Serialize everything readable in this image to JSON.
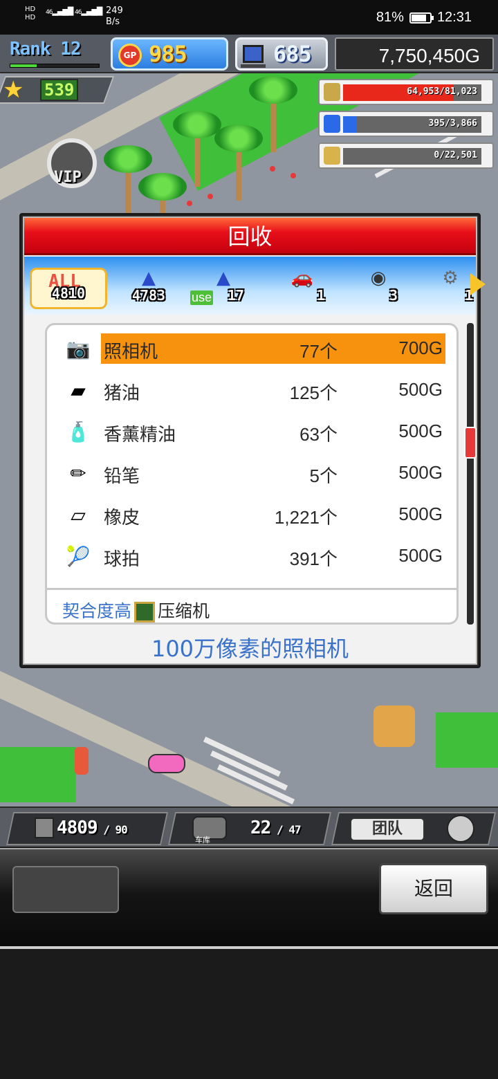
{
  "status_bar": {
    "sim_labels": [
      "HD",
      "HD"
    ],
    "sim1": "46",
    "sim2": "46",
    "net_speed": "249",
    "net_unit": "B/s",
    "battery": "81%",
    "battery_level": 0.81,
    "time": "12:31"
  },
  "hud": {
    "rank_label": "Rank",
    "rank_value": "12",
    "rank_progress": 0.3,
    "gp_icon_text": "GP",
    "gp_value": "985",
    "pc_value": "685",
    "money": "7,750,450G",
    "star_value": "539",
    "resources": [
      {
        "text": "64,953/81,023",
        "fraction": 0.8,
        "color": "#e8281a",
        "icon": "coin-stack-icon"
      },
      {
        "text": "395/3,866",
        "fraction": 0.1,
        "color": "#2a6ae8",
        "icon": "fuel-can-icon"
      },
      {
        "text": "0/22,501",
        "fraction": 0.0,
        "color": "#888888",
        "icon": "wheat-icon"
      }
    ],
    "vip_label": "VIP"
  },
  "dialog": {
    "title": "回收",
    "tabs": [
      {
        "label": "ALL",
        "count": "4810",
        "icon": "all-icon"
      },
      {
        "count": "4783",
        "icon": "item-dome-icon"
      },
      {
        "use_label": "use",
        "count": "17",
        "icon": "item-dome-use-icon"
      },
      {
        "count": "1",
        "icon": "car-icon"
      },
      {
        "count": "3",
        "icon": "tire-icon"
      },
      {
        "count": "1",
        "icon": "engine-icon"
      }
    ],
    "items": [
      {
        "name": "照相机",
        "qty": "77个",
        "price": "700G",
        "icon": "camera-icon",
        "selected": true
      },
      {
        "name": "猪油",
        "qty": "125个",
        "price": "500G",
        "icon": "lard-icon",
        "selected": false
      },
      {
        "name": "香薰精油",
        "qty": "63个",
        "price": "500G",
        "icon": "perfume-bottle-icon",
        "selected": false
      },
      {
        "name": "铅笔",
        "qty": "5个",
        "price": "500G",
        "icon": "pencil-icon",
        "selected": false
      },
      {
        "name": "橡皮",
        "qty": "1,221个",
        "price": "500G",
        "icon": "eraser-icon",
        "selected": false
      },
      {
        "name": "球拍",
        "qty": "391个",
        "price": "500G",
        "icon": "racket-icon",
        "selected": false
      }
    ],
    "affinity_label": "契合度高",
    "affinity_item": "压缩机",
    "description": "100万像素的照相机"
  },
  "bottom_hud": {
    "seg1_value": "4809",
    "seg1_max": "90",
    "garage_label": "车库",
    "seg2_value": "22",
    "seg2_max": "47",
    "team_label": "团队"
  },
  "controls": {
    "back_label": "返回"
  }
}
